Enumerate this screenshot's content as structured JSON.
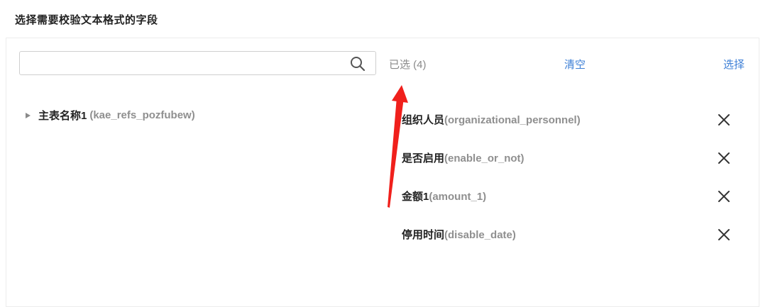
{
  "header": {
    "title": "选择需要校验文本格式的字段"
  },
  "search": {
    "value": "",
    "placeholder": "",
    "icon": "search-icon"
  },
  "selected_panel": {
    "count_label": "已选 (4)",
    "clear_label": "清空",
    "select_label": "选择"
  },
  "tree": {
    "nodes": [
      {
        "name": "主表名称1",
        "code": "(kae_refs_pozfubew)",
        "expanded": false
      }
    ]
  },
  "selected_items": [
    {
      "label": "组织人员",
      "code": "(organizational_personnel)"
    },
    {
      "label": "是否启用",
      "code": "(enable_or_not)"
    },
    {
      "label": "金额1",
      "code": "(amount_1)"
    },
    {
      "label": "停用时间",
      "code": "(disable_date)"
    }
  ],
  "colors": {
    "link": "#3d7fd6",
    "muted": "#8f8f8f",
    "annotation_arrow": "#f0201c"
  }
}
